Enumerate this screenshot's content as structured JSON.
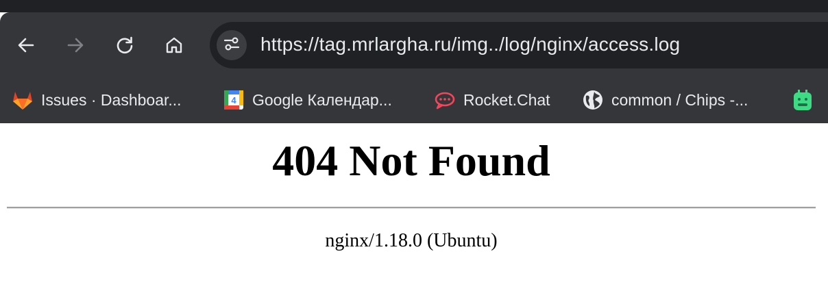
{
  "browser": {
    "address_bar": {
      "url": "https://tag.mrlargha.ru/img../log/nginx/access.log"
    },
    "toolbar_icons": [
      "back-icon",
      "forward-icon",
      "reload-icon",
      "home-icon",
      "site-info-icon"
    ],
    "bookmarks": [
      {
        "label": "Issues · Dashboar...",
        "icon": "gitlab-icon",
        "color": "#e24329"
      },
      {
        "label": "Google Календар...",
        "icon": "google-calendar-icon",
        "color": "#4285f4",
        "badge": "4"
      },
      {
        "label": "Rocket.Chat",
        "icon": "rocket-chat-icon",
        "color": "#f5455c"
      },
      {
        "label": "common / Chips -...",
        "icon": "globe-icon",
        "color": "#e8eaed"
      },
      {
        "label": "",
        "icon": "android-icon",
        "color": "#3ddc84"
      }
    ]
  },
  "page": {
    "heading": "404 Not Found",
    "server_signature": "nginx/1.18.0 (Ubuntu)"
  },
  "colors": {
    "toolbar_bg": "#35363a",
    "omnibox_bg": "#202124",
    "text_light": "#e8eaed",
    "icon_disabled": "#7f8187"
  }
}
